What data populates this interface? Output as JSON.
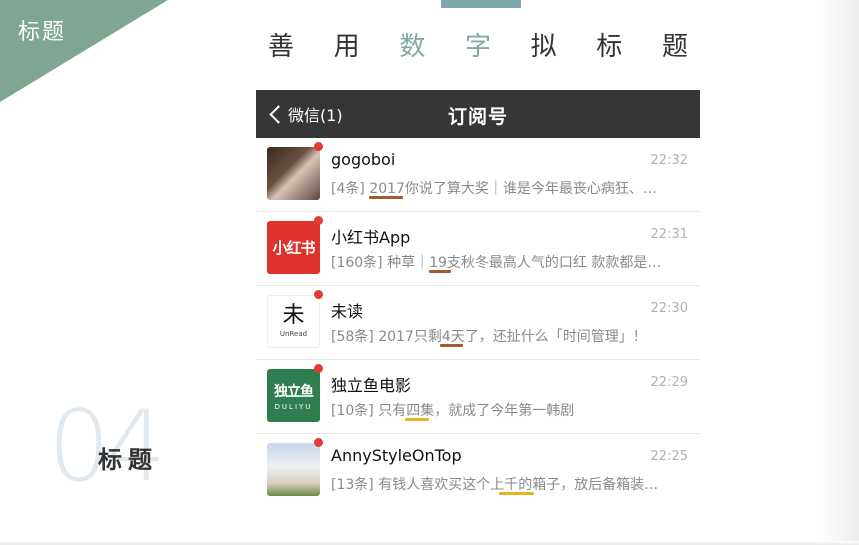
{
  "corner_badge": {
    "label": "标题"
  },
  "headline": {
    "chars": [
      {
        "text": "善",
        "highlight": false
      },
      {
        "text": "用",
        "highlight": false
      },
      {
        "text": "数",
        "highlight": true
      },
      {
        "text": "字",
        "highlight": true
      },
      {
        "text": "拟",
        "highlight": false
      },
      {
        "text": "标",
        "highlight": false
      },
      {
        "text": "题",
        "highlight": false
      }
    ]
  },
  "section": {
    "number": "04",
    "title": "标题"
  },
  "nav": {
    "back_label": "微信(1)",
    "title": "订阅号"
  },
  "subscriptions": [
    {
      "name": "gogoboi",
      "time": "22:32",
      "preview": "[4条] 2017你说了算大奖｜谁是今年最丧心病狂、…",
      "avatar_icon": "gogoboi-avatar",
      "unread": true
    },
    {
      "name": "小红书App",
      "time": "22:31",
      "preview": "[160条] 种草｜19支秋冬最高人气的口红 款款都是…",
      "avatar_icon": "xiaohongshu-avatar",
      "avatar_text": "小红书",
      "unread": true
    },
    {
      "name": "未读",
      "time": "22:30",
      "preview": "[58条] 2017只剩4天了，还扯什么「时间管理」！",
      "avatar_icon": "unread-avatar",
      "avatar_text": "未",
      "avatar_sub": "UnRead",
      "unread": true
    },
    {
      "name": "独立鱼电影",
      "time": "22:29",
      "preview": "[10条] 只有四集，就成了今年第一韩剧",
      "avatar_icon": "duliyu-avatar",
      "avatar_text": "独立鱼",
      "avatar_sub": "DULIYU",
      "unread": true
    },
    {
      "name": "AnnyStyleOnTop",
      "time": "22:25",
      "preview": "[13条] 有钱人喜欢买这个上千的箱子，放后备箱装…",
      "avatar_icon": "annystyle-avatar",
      "unread": true
    }
  ],
  "colors": {
    "accent": "#7fa593",
    "highlight": "#7faaa5",
    "nav_bg": "#363638",
    "unread_dot": "#e23c33",
    "underline_brown": "#a65a27",
    "underline_gold": "#e5b521"
  }
}
